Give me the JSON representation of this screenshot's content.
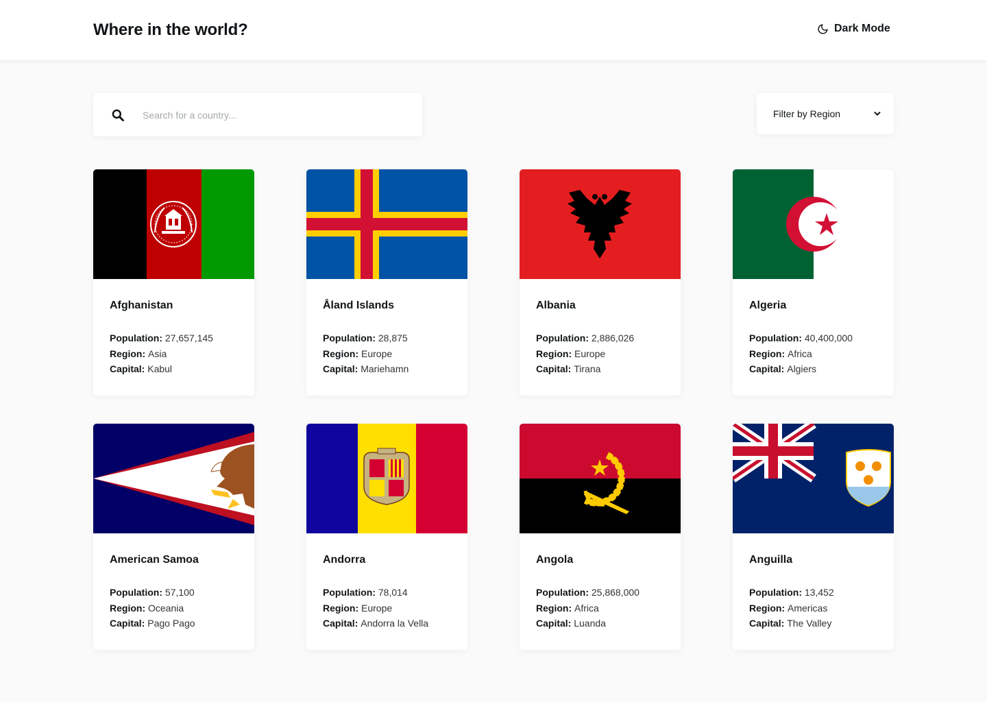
{
  "header": {
    "title": "Where in the world?",
    "dark_mode_label": "Dark Mode",
    "dark_mode_icon": "moon-icon"
  },
  "search": {
    "placeholder": "Search for a country...",
    "value": "",
    "icon": "search-icon"
  },
  "filter": {
    "label": "Filter by Region",
    "icon": "chevron-down-icon"
  },
  "labels": {
    "population": "Population:",
    "region": "Region:",
    "capital": "Capital:"
  },
  "countries": [
    {
      "name": "Afghanistan",
      "population": "27,657,145",
      "region": "Asia",
      "capital": "Kabul",
      "flag": "afghanistan-flag"
    },
    {
      "name": "Åland Islands",
      "population": "28,875",
      "region": "Europe",
      "capital": "Mariehamn",
      "flag": "aland-flag"
    },
    {
      "name": "Albania",
      "population": "2,886,026",
      "region": "Europe",
      "capital": "Tirana",
      "flag": "albania-flag"
    },
    {
      "name": "Algeria",
      "population": "40,400,000",
      "region": "Africa",
      "capital": "Algiers",
      "flag": "algeria-flag"
    },
    {
      "name": "American Samoa",
      "population": "57,100",
      "region": "Oceania",
      "capital": "Pago Pago",
      "flag": "american-samoa-flag"
    },
    {
      "name": "Andorra",
      "population": "78,014",
      "region": "Europe",
      "capital": "Andorra la Vella",
      "flag": "andorra-flag"
    },
    {
      "name": "Angola",
      "population": "25,868,000",
      "region": "Africa",
      "capital": "Luanda",
      "flag": "angola-flag"
    },
    {
      "name": "Anguilla",
      "population": "13,452",
      "region": "Americas",
      "capital": "The Valley",
      "flag": "anguilla-flag"
    }
  ],
  "colors": {
    "background": "#fafafa",
    "element": "#ffffff",
    "text": "#111517",
    "placeholder": "#a4a8ab"
  }
}
